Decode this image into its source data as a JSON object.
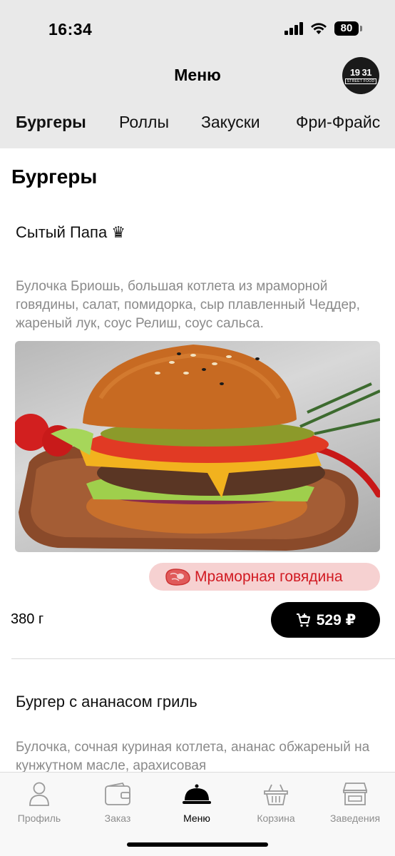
{
  "status_bar": {
    "time": "16:34",
    "battery": "80"
  },
  "header": {
    "title": "Меню",
    "logo_number": "19 31",
    "logo_sub": "STREET FOOD"
  },
  "category_tabs": [
    {
      "label": "Бургеры",
      "active": true
    },
    {
      "label": "Роллы",
      "active": false
    },
    {
      "label": "Закуски",
      "active": false
    },
    {
      "label": "Фри-Фрайс",
      "active": false
    }
  ],
  "section": {
    "title": "Бургеры"
  },
  "items": [
    {
      "name": "Сытый Папа ♛",
      "description": "Булочка Бриошь, большая котлета из мраморной говядины, салат, помидорка, сыр плавленный Чеддер, жареный лук, соус Релиш, соус сальса.",
      "tag": "Мраморная говядина",
      "weight": "380 г",
      "price": "529 ₽"
    },
    {
      "name": "Бургер с ананасом гриль",
      "description": "Булочка, сочная куриная котлета, ананас обжареный на кунжутном масле, арахисовая"
    }
  ],
  "tabbar": [
    {
      "label": "Профиль",
      "icon": "profile-icon",
      "active": false
    },
    {
      "label": "Заказ",
      "icon": "wallet-icon",
      "active": false
    },
    {
      "label": "Меню",
      "icon": "cloche-icon",
      "active": true
    },
    {
      "label": "Корзина",
      "icon": "basket-icon",
      "active": false
    },
    {
      "label": "Заведения",
      "icon": "store-icon",
      "active": false
    }
  ],
  "colors": {
    "accent": "#000000",
    "tag_bg": "#f6d1d1",
    "tag_text": "#d11a22",
    "header_bg": "#e9e9e9"
  }
}
